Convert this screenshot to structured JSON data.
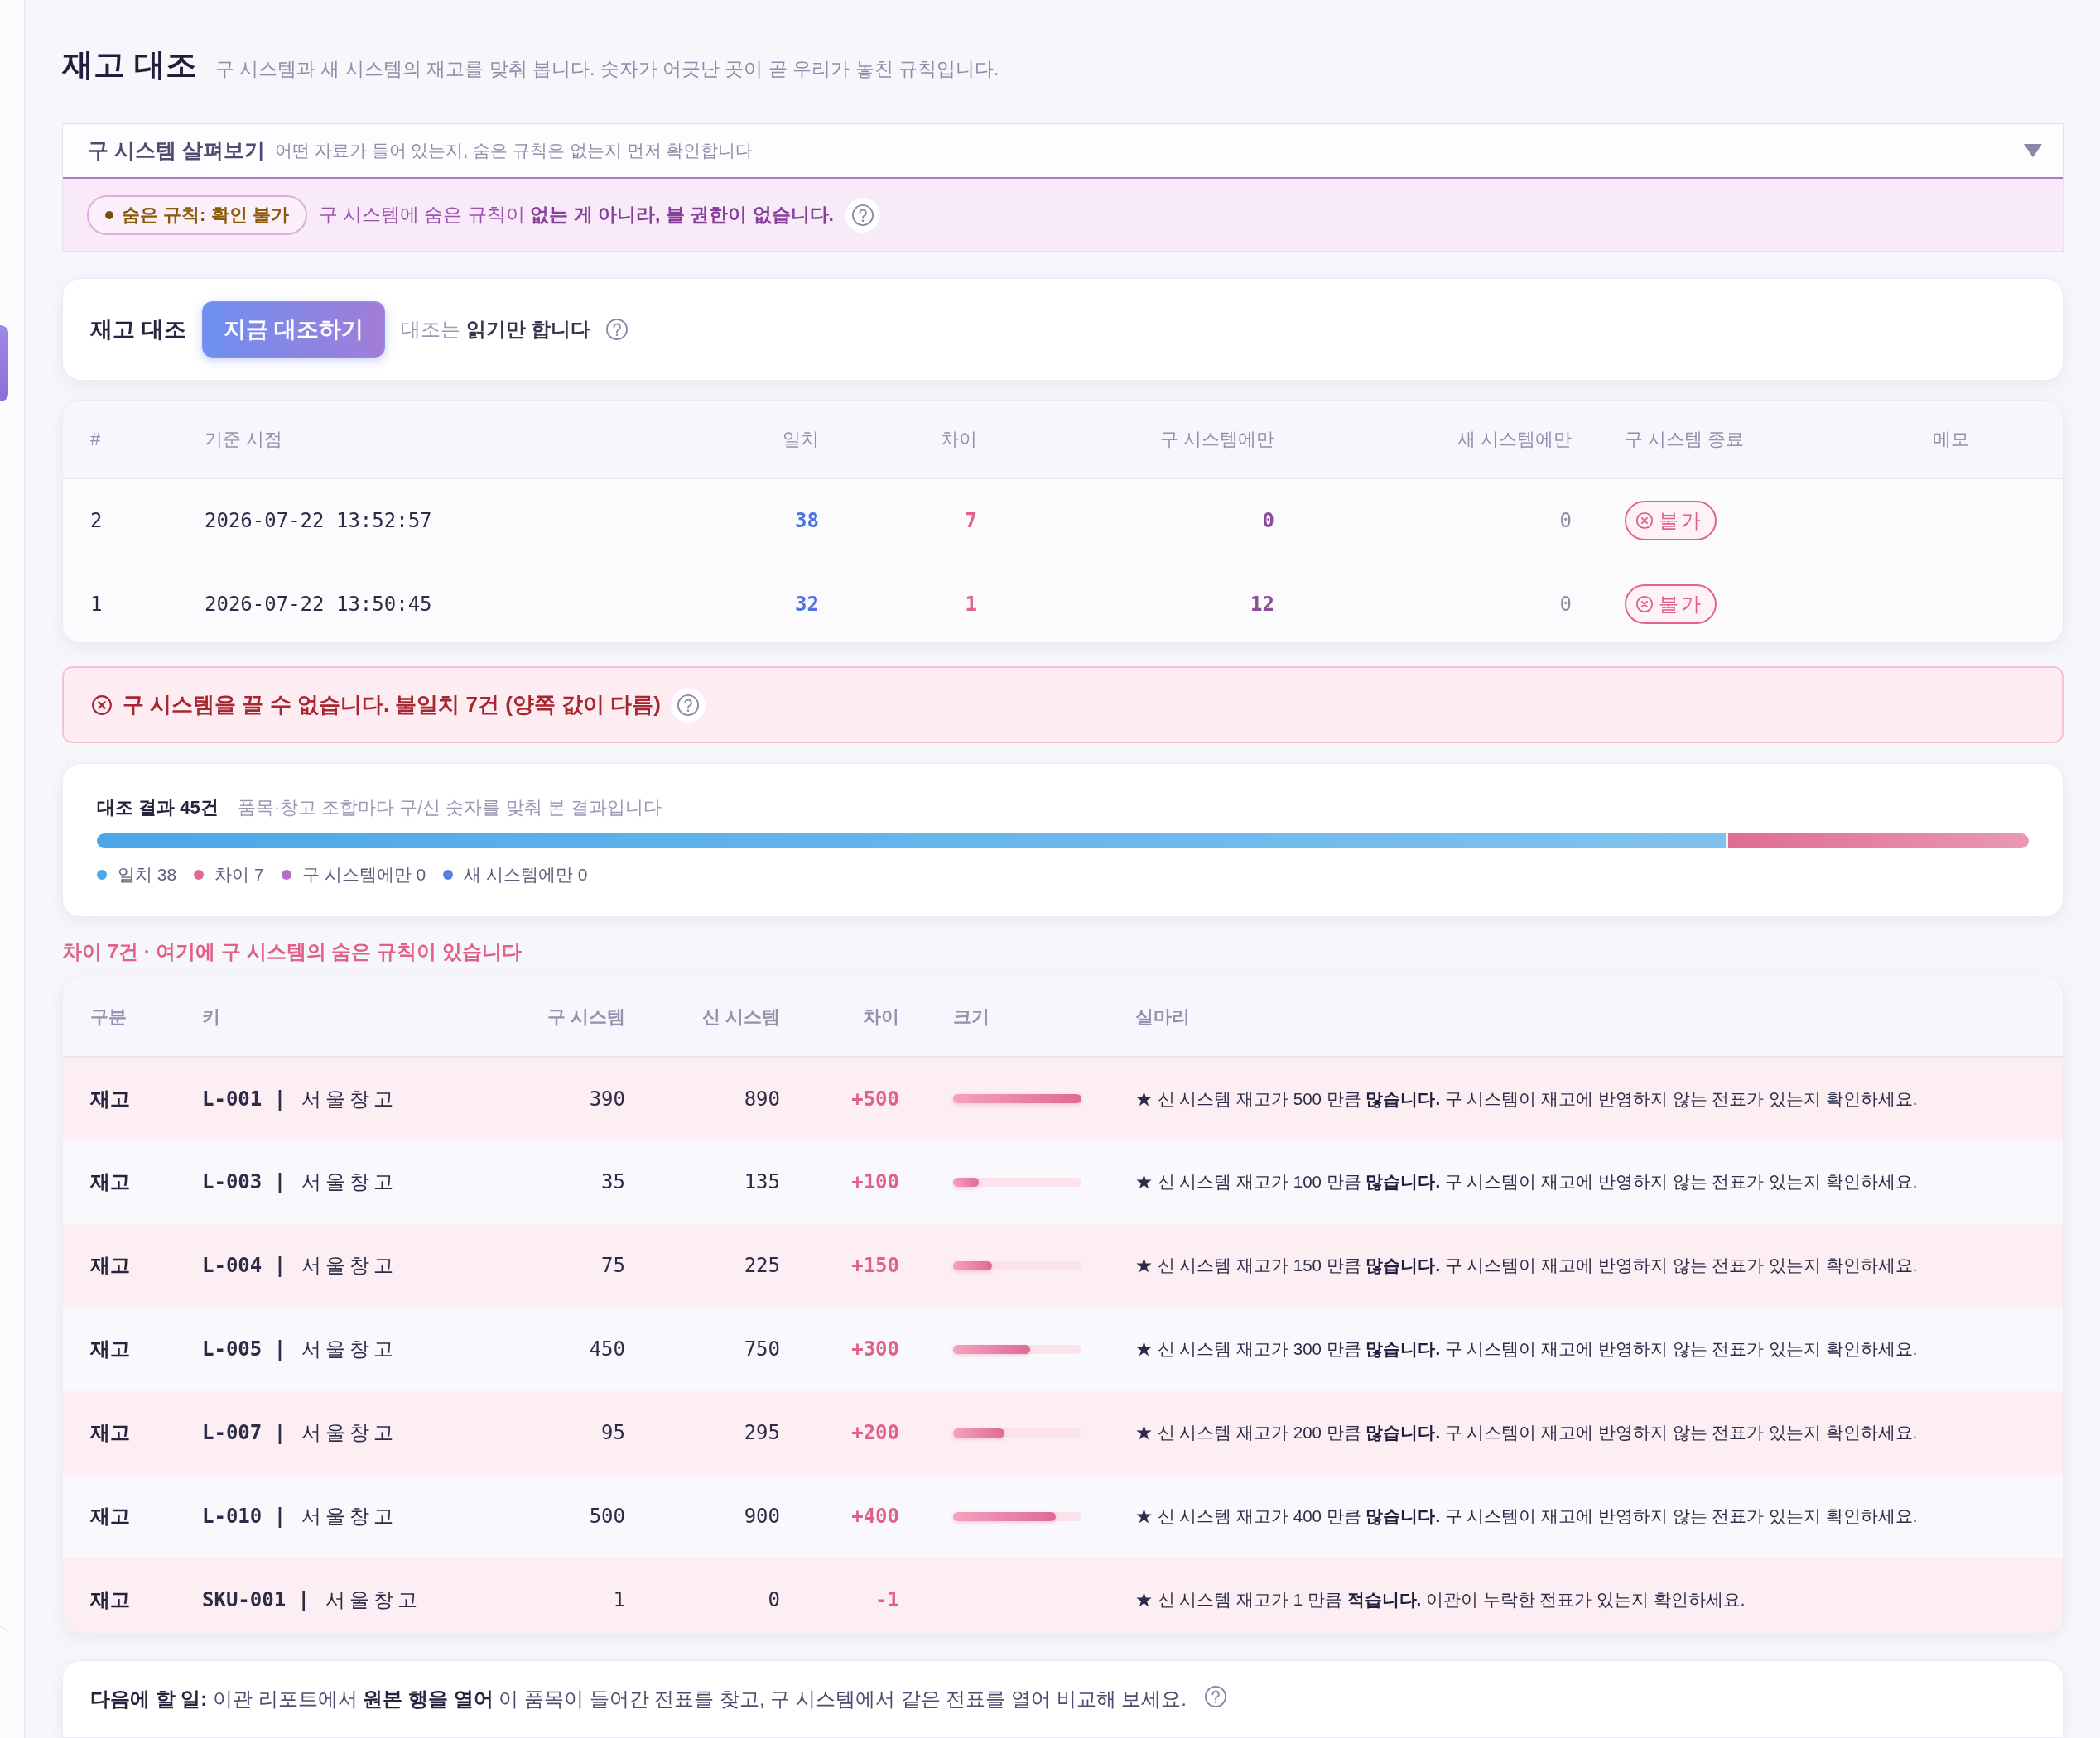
{
  "page": {
    "title": "재고 대조",
    "subtitle": "구 시스템과 새 시스템의 재고를 맞춰 봅니다. 숫자가 어긋난 곳이 곧 우리가 놓친 규칙입니다."
  },
  "legacy_panel": {
    "title": "구 시스템 살펴보기",
    "description": "어떤 자료가 들어 있는지, 숨은 규칙은 없는지 먼저 확인합니다",
    "badge": "숨은 규칙: 확인 불가",
    "notice": "구 시스템에 숨은 규칙이 **없는 게 아니라, 볼 권한이 없습니다.**"
  },
  "reconcile": {
    "title": "재고 대조",
    "button": "지금 대조하기",
    "note": "대조는 **읽기만 합니다**"
  },
  "runs": {
    "columns": [
      "#",
      "기준 시점",
      "일치",
      "차이",
      "구 시스템에만",
      "새 시스템에만",
      "구 시스템 종료",
      "메모"
    ],
    "rows": [
      {
        "no": "2",
        "time": "2026-07-22 13:52:57",
        "match": "38",
        "diff": "7",
        "old_only": "0",
        "new_only": "0",
        "shutdown": "불가"
      },
      {
        "no": "1",
        "time": "2026-07-22 13:50:45",
        "match": "32",
        "diff": "1",
        "old_only": "12",
        "new_only": "0",
        "shutdown": "불가"
      }
    ]
  },
  "blocker": {
    "message": "구 시스템을 끌 수 없습니다. 불일치 7건 (양쪽 값이 다름)"
  },
  "summary": {
    "title": "대조 결과 45건",
    "description": "품목·창고 조합마다 구/신 숫자를 맞춰 본 결과입니다",
    "segments": [
      {
        "label": "일치 38",
        "color": "#4aa8e8",
        "level": 0.844
      },
      {
        "label": "차이 7",
        "color": "#e06c94",
        "level": 0.156
      },
      {
        "label": "구 시스템에만 0",
        "color": "#b56fc8"
      },
      {
        "label": "새 시스템에만 0",
        "color": "#5a7de0"
      }
    ]
  },
  "differences": {
    "heading": "차이 7건 · 여기에 구 시스템의 숨은 규칙이 있습니다",
    "columns": [
      "구분",
      "키",
      "구 시스템",
      "신 시스템",
      "차이",
      "크기",
      "실마리"
    ],
    "rows": [
      {
        "category": "재고",
        "key": "**L-001 |** 서울창고",
        "old": "390",
        "new": "890",
        "diff": "+500",
        "level": 1,
        "clue": "★ 신 시스템 재고가 500 만큼 **많습니다.** 구 시스템이 재고에 반영하지 않는 전표가 있는지 확인하세요."
      },
      {
        "category": "재고",
        "key": "**L-003 |** 서울창고",
        "old": "35",
        "new": "135",
        "diff": "+100",
        "level": 0.2,
        "clue": "★ 신 시스템 재고가 100 만큼 **많습니다.** 구 시스템이 재고에 반영하지 않는 전표가 있는지 확인하세요."
      },
      {
        "category": "재고",
        "key": "**L-004 |** 서울창고",
        "old": "75",
        "new": "225",
        "diff": "+150",
        "level": 0.3,
        "clue": "★ 신 시스템 재고가 150 만큼 **많습니다.** 구 시스템이 재고에 반영하지 않는 전표가 있는지 확인하세요."
      },
      {
        "category": "재고",
        "key": "**L-005 |** 서울창고",
        "old": "450",
        "new": "750",
        "diff": "+300",
        "level": 0.6,
        "clue": "★ 신 시스템 재고가 300 만큼 **많습니다.** 구 시스템이 재고에 반영하지 않는 전표가 있는지 확인하세요."
      },
      {
        "category": "재고",
        "key": "**L-007 |** 서울창고",
        "old": "95",
        "new": "295",
        "diff": "+200",
        "level": 0.4,
        "clue": "★ 신 시스템 재고가 200 만큼 **많습니다.** 구 시스템이 재고에 반영하지 않는 전표가 있는지 확인하세요."
      },
      {
        "category": "재고",
        "key": "**L-010 |** 서울창고",
        "old": "500",
        "new": "900",
        "diff": "+400",
        "level": 0.8,
        "clue": "★ 신 시스템 재고가 400 만큼 **많습니다.** 구 시스템이 재고에 반영하지 않는 전표가 있는지 확인하세요."
      },
      {
        "category": "재고",
        "key": "**SKU-001 |** 서울창고",
        "old": "1",
        "new": "0",
        "diff": "-1",
        "clue": "★ 신 시스템 재고가 1 만큼 **적습니다.** 이관이 누락한 전표가 있는지 확인하세요."
      }
    ]
  },
  "next_step": {
    "text": "**다음에 할 일:** 이관 리포트에서 **원본 행을 열어** 이 품목이 들어간 전표를 찾고, 구 시스템에서 같은 전표를 열어 비교해 보세요."
  }
}
